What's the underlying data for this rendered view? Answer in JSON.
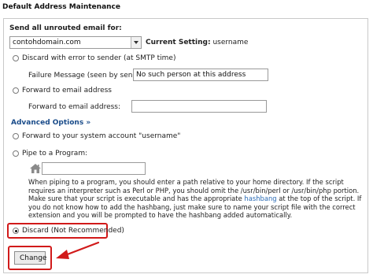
{
  "page": {
    "title": "Default Address Maintenance"
  },
  "send_all": {
    "label": "Send all unrouted email for:"
  },
  "domain_select": {
    "value": "contohdomain.com"
  },
  "current_setting": {
    "label": "Current Setting:",
    "value": "username"
  },
  "options": {
    "discard_error": {
      "label": "Discard with error to sender (at SMTP time)",
      "checked": false
    },
    "failure_message": {
      "label": "Failure Message (seen by sender):",
      "value": "No such person at this address"
    },
    "forward_email": {
      "label": "Forward to email address",
      "checked": false
    },
    "forward_to": {
      "label": "Forward to email address:",
      "value": ""
    },
    "advanced": {
      "label": "Advanced Options »"
    },
    "forward_system": {
      "label": "Forward to your system account \"username\"",
      "checked": false
    },
    "pipe": {
      "label": "Pipe to a Program:",
      "checked": false,
      "value": ""
    },
    "pipe_help": {
      "part1": "When piping to a program, you should enter a path relative to your home directory. If the script requires an interpreter such as Perl or PHP, you should omit the /usr/bin/perl or /usr/bin/php portion. Make sure that your script is executable and has the appropriate ",
      "link": "hashbang",
      "part2": " at the top of the script. If you do not know how to add the hashbang, just make sure to name your script file with the correct extension and you will be prompted to have the hashbang added automatically."
    },
    "discard": {
      "label": "Discard (Not Recommended)",
      "checked": true
    }
  },
  "change_button": {
    "label": "Change"
  },
  "icons": {
    "home": "home-icon",
    "arrow": "red-arrow-annotation"
  },
  "colors": {
    "highlight": "#d11a1a",
    "link": "#1a4c8a"
  }
}
